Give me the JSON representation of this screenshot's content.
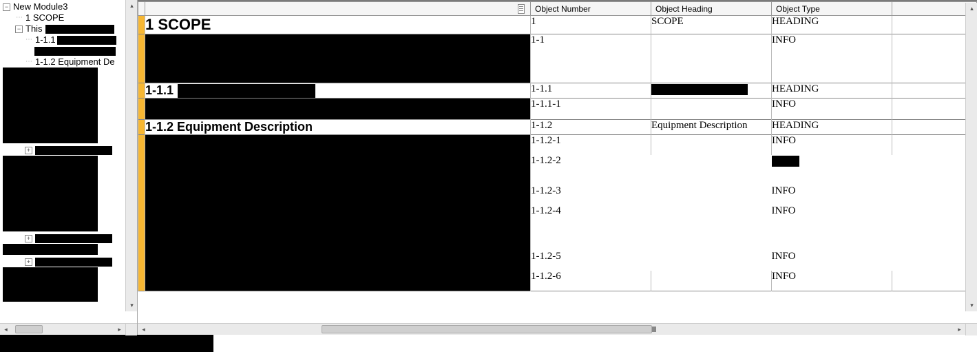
{
  "tree": {
    "root": {
      "label": "New Module3"
    },
    "n1": {
      "label": "1 SCOPE"
    },
    "n2": {
      "prefix": "This"
    },
    "n3": {
      "prefix": "1-1.1"
    },
    "n5": {
      "label": "1-1.2 Equipment De"
    }
  },
  "columns": {
    "c1": "",
    "c2": "Object Number",
    "c3": "Object Heading",
    "c4": "Object Type"
  },
  "rows": {
    "r1": {
      "main": "1 SCOPE",
      "num": "1",
      "head": "SCOPE",
      "type": "HEADING"
    },
    "r2": {
      "num": "1-1",
      "head": "",
      "type": "INFO"
    },
    "r3": {
      "main_prefix": "1-1.1",
      "num": "1-1.1",
      "head_redacted": true,
      "type": "HEADING"
    },
    "r4": {
      "num": "1-1.1-1",
      "head": "",
      "type": "INFO"
    },
    "r5": {
      "main": "1-1.2 Equipment Description",
      "num": "1-1.2",
      "head": "Equipment Description",
      "type": "HEADING"
    },
    "r6": {
      "num": "1-1.2-1",
      "head": "",
      "type": "INFO"
    },
    "r7": {
      "num": "1-1.2-2",
      "head": "",
      "type_redacted": true
    },
    "r8": {
      "num": "1-1.2-3",
      "head": "",
      "type": "INFO"
    },
    "r9": {
      "num": "1-1.2-4",
      "head": "",
      "type": "INFO"
    },
    "r10": {
      "num": "1-1.2-5",
      "head": "",
      "type": "INFO"
    },
    "r11": {
      "num": "1-1.2-6",
      "head": "",
      "type": "INFO"
    }
  }
}
